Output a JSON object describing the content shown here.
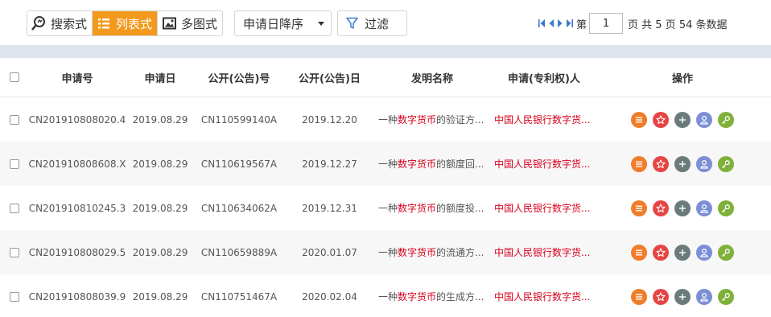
{
  "toolbar": {
    "views": [
      {
        "label": "搜索式",
        "icon": "search-style-icon",
        "active": false
      },
      {
        "label": "列表式",
        "icon": "list-icon",
        "active": true
      },
      {
        "label": "多图式",
        "icon": "image-icon",
        "active": false
      }
    ],
    "sort_value": "申请日降序",
    "filter_label": "过滤"
  },
  "pager": {
    "prefix": "第",
    "page": "1",
    "total_text": "页 共 5 页 54 条数据"
  },
  "table": {
    "headers": [
      "申请号",
      "申请日",
      "公开(公告)号",
      "公开(公告)日",
      "发明名称",
      "申请(专利权)人",
      "操作"
    ],
    "rows": [
      {
        "app_no": "CN201910808020.4",
        "app_date": "2019.08.29",
        "pub_no": "CN110599140A",
        "pub_date": "2019.12.20",
        "title_pre": "一种",
        "title_hl": "数字货币",
        "title_post": "的验证方...",
        "applicant": "中国人民银行数字货..."
      },
      {
        "app_no": "CN201910808608.X",
        "app_date": "2019.08.29",
        "pub_no": "CN110619567A",
        "pub_date": "2019.12.27",
        "title_pre": "一种",
        "title_hl": "数字货币",
        "title_post": "的额度回...",
        "applicant": "中国人民银行数字货..."
      },
      {
        "app_no": "CN201910810245.3",
        "app_date": "2019.08.29",
        "pub_no": "CN110634062A",
        "pub_date": "2019.12.31",
        "title_pre": "一种",
        "title_hl": "数字货币",
        "title_post": "的额度投...",
        "applicant": "中国人民银行数字货..."
      },
      {
        "app_no": "CN201910808029.5",
        "app_date": "2019.08.29",
        "pub_no": "CN110659889A",
        "pub_date": "2020.01.07",
        "title_pre": "一种",
        "title_hl": "数字货币",
        "title_post": "的流通方...",
        "applicant": "中国人民银行数字货..."
      },
      {
        "app_no": "CN201910808039.9",
        "app_date": "2019.08.29",
        "pub_no": "CN110751467A",
        "pub_date": "2020.02.04",
        "title_pre": "一种",
        "title_hl": "数字货币",
        "title_post": "的生成方...",
        "applicant": "中国人民银行数字货..."
      }
    ],
    "actions": [
      {
        "name": "menu-action",
        "icon": "menu-icon",
        "color": "#f07d2a"
      },
      {
        "name": "favorite-action",
        "icon": "star-icon",
        "color": "#e64545"
      },
      {
        "name": "add-action",
        "icon": "plus-icon",
        "color": "#6b7b7b"
      },
      {
        "name": "user-action",
        "icon": "user-icon",
        "color": "#7b8fd6"
      },
      {
        "name": "key-action",
        "icon": "key-icon",
        "color": "#7fb13a"
      }
    ]
  },
  "colors": {
    "accent": "#f39a1e",
    "highlight": "#d9001b",
    "page_bg": "#dfe4ec"
  }
}
